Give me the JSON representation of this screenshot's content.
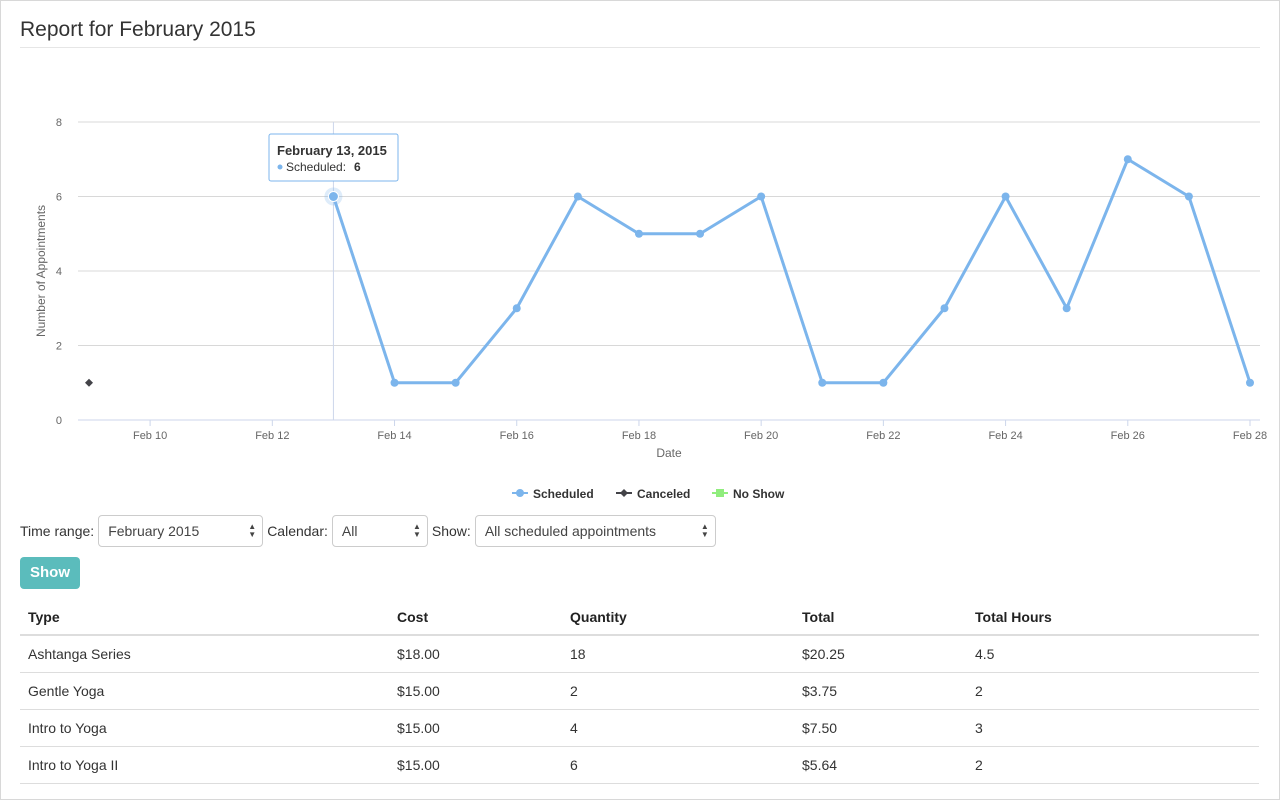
{
  "page": {
    "title": "Report for February 2015"
  },
  "tooltip": {
    "date": "February 13, 2015",
    "series_label": "Scheduled:",
    "value": "6"
  },
  "chart_data": {
    "type": "line",
    "x": [
      "2015-02-13",
      "2015-02-14",
      "2015-02-15",
      "2015-02-16",
      "2015-02-17",
      "2015-02-18",
      "2015-02-19",
      "2015-02-20",
      "2015-02-21",
      "2015-02-22",
      "2015-02-23",
      "2015-02-24",
      "2015-02-25",
      "2015-02-26",
      "2015-02-27",
      "2015-02-28"
    ],
    "series": [
      {
        "name": "Scheduled",
        "color": "#7cb5ec",
        "x": [
          "2015-02-13",
          "2015-02-14",
          "2015-02-15",
          "2015-02-16",
          "2015-02-17",
          "2015-02-18",
          "2015-02-19",
          "2015-02-20",
          "2015-02-21",
          "2015-02-22",
          "2015-02-23",
          "2015-02-24",
          "2015-02-25",
          "2015-02-26",
          "2015-02-27",
          "2015-02-28"
        ],
        "values": [
          6,
          1,
          1,
          3,
          6,
          5,
          5,
          6,
          1,
          1,
          3,
          6,
          3,
          7,
          6,
          1
        ]
      },
      {
        "name": "Canceled",
        "color": "#434348",
        "x": [
          "2015-02-09"
        ],
        "values": [
          1
        ]
      },
      {
        "name": "No Show",
        "color": "#90ed7d",
        "x": [],
        "values": []
      }
    ],
    "xlabel": "Date",
    "ylabel": "Number of Appointments",
    "xticks": [
      "Feb 10",
      "Feb 12",
      "Feb 14",
      "Feb 16",
      "Feb 18",
      "Feb 20",
      "Feb 22",
      "Feb 24",
      "Feb 26",
      "Feb 28"
    ],
    "yticks": [
      "0",
      "2",
      "4",
      "6",
      "8"
    ],
    "ylim": [
      0,
      8
    ],
    "xlim": [
      "2015-02-09",
      "2015-02-28"
    ],
    "grid": true,
    "legend": "bottom-center"
  },
  "controls": {
    "time_range": {
      "label": "Time range:",
      "value": "February 2015"
    },
    "calendar": {
      "label": "Calendar:",
      "value": "All"
    },
    "show": {
      "label": "Show:",
      "value": "All scheduled appointments"
    },
    "show_button": "Show"
  },
  "table": {
    "headers": [
      "Type",
      "Cost",
      "Quantity",
      "Total",
      "Total Hours"
    ],
    "rows": [
      [
        "Ashtanga Series",
        "$18.00",
        "18",
        "$20.25",
        "4.5"
      ],
      [
        "Gentle Yoga",
        "$15.00",
        "2",
        "$3.75",
        "2"
      ],
      [
        "Intro to Yoga",
        "$15.00",
        "4",
        "$7.50",
        "3"
      ],
      [
        "Intro to Yoga II",
        "$15.00",
        "6",
        "$5.64",
        "2"
      ]
    ]
  }
}
